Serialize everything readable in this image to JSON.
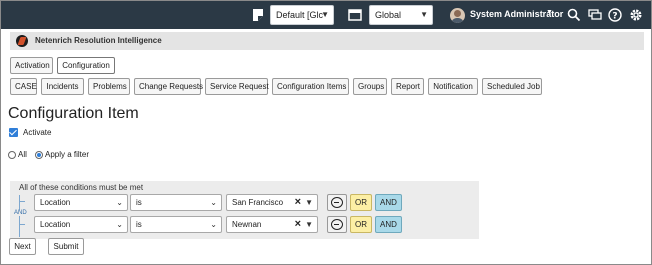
{
  "topbar": {
    "domain_select": "Default [Glc",
    "scope_select": "Global",
    "user_name": "System Administrator"
  },
  "app": {
    "title": "Netenrich Resolution Intelligence"
  },
  "mode_tabs": [
    "Activation",
    "Configuration"
  ],
  "module_tabs": [
    "CASE",
    "Incidents",
    "Problems",
    "Change Requests",
    "Service Request",
    "Configuration Items",
    "Groups",
    "Report",
    "Notification",
    "Scheduled Job"
  ],
  "page": {
    "title": "Configuration Item",
    "activate_label": "Activate",
    "radio_all": "All",
    "radio_filter": "Apply a filter"
  },
  "conditions": {
    "header": "All of these conditions must be met",
    "and_label": "AND",
    "or_label": "OR",
    "and_btn_label": "AND",
    "rows": [
      {
        "field": "Location",
        "operator": "is",
        "value": "San Francisco"
      },
      {
        "field": "Location",
        "operator": "is",
        "value": "Newnan"
      }
    ]
  },
  "footer": {
    "next": "Next",
    "submit": "Submit"
  },
  "colors": {
    "topbar": "#2b3945",
    "accent": "#2f7ed8",
    "or": "#fcefa5",
    "and": "#a9d9e9"
  }
}
